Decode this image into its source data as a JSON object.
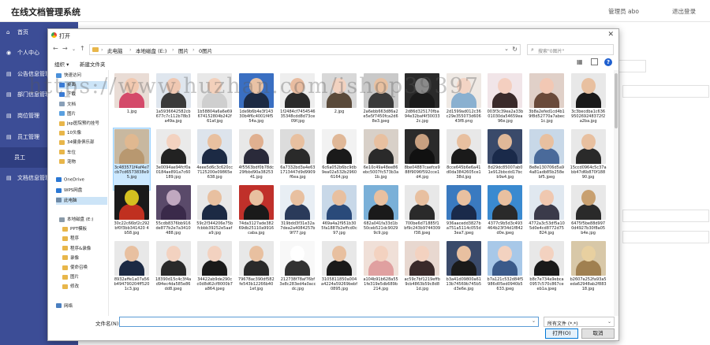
{
  "app": {
    "title": "在线文档管理系统",
    "user": "管理员 abo",
    "logout": "退出登录"
  },
  "sidebar": {
    "items": [
      {
        "label": "首页",
        "glyph": "⌂"
      },
      {
        "label": "个人中心",
        "glyph": "◉"
      },
      {
        "label": "公告信息管理",
        "glyph": "▤"
      },
      {
        "label": "部门信息管理",
        "glyph": "▤"
      },
      {
        "label": "岗位管理",
        "glyph": "▤"
      },
      {
        "label": "员工管理",
        "glyph": "▤"
      },
      {
        "label": "员工",
        "glyph": ""
      },
      {
        "label": "文档信息管理",
        "glyph": "▤"
      }
    ]
  },
  "dialog": {
    "title": "打开",
    "close": "✕",
    "breadcrumbs": [
      "此电脑",
      "本地磁盘 (E:)",
      "图片",
      "0图片"
    ],
    "search_placeholder": "搜索\"0图片\"",
    "organize": "组织 ▾",
    "new_folder": "新建文件夹",
    "help": "?"
  },
  "nav_tree": [
    {
      "label": "快速访问",
      "color": "#4a90d9",
      "pin": false,
      "selected": false
    },
    {
      "label": "桌面",
      "color": "#3a7bd5",
      "pin": true,
      "selected": true
    },
    {
      "label": "下载",
      "color": "#3a7bd5",
      "pin": true,
      "selected": false
    },
    {
      "label": "文档",
      "color": "#8aa0b8",
      "pin": true,
      "selected": false
    },
    {
      "label": "图片",
      "color": "#5aa0e0",
      "pin": true,
      "selected": false
    },
    {
      "label": "jsp医院预约挂号",
      "color": "#e8b64a",
      "pin": false,
      "selected": false
    },
    {
      "label": "10头像",
      "color": "#e8b64a",
      "pin": false,
      "selected": false
    },
    {
      "label": "34健身俱乐部",
      "color": "#e8b64a",
      "pin": false,
      "selected": false
    },
    {
      "label": "车位",
      "color": "#e8b64a",
      "pin": false,
      "selected": false
    },
    {
      "label": "宠物",
      "color": "#e8b64a",
      "pin": false,
      "selected": false
    },
    {
      "label": "",
      "color": "",
      "pin": false,
      "selected": false
    },
    {
      "label": "OneDrive",
      "color": "#2b78d4",
      "pin": false,
      "selected": false
    },
    {
      "label": "WPS网盘",
      "color": "#2b78d4",
      "pin": false,
      "selected": false
    },
    {
      "label": "此电脑",
      "color": "#6f8aa6",
      "pin": false,
      "selected": true
    },
    {
      "label": "",
      "color": "",
      "pin": false,
      "selected": false
    },
    {
      "label": "本地磁盘 (E:)",
      "color": "#8a9aa8",
      "pin": false,
      "selected": false
    },
    {
      "label": "PPT模板",
      "color": "#e8b64a",
      "pin": false,
      "selected": false
    },
    {
      "label": "程序",
      "color": "#e8b64a",
      "pin": false,
      "selected": false
    },
    {
      "label": "程序&录像",
      "color": "#e8b64a",
      "pin": false,
      "selected": false
    },
    {
      "label": "录像",
      "color": "#e8b64a",
      "pin": false,
      "selected": false
    },
    {
      "label": "使命召唤",
      "color": "#e8b64a",
      "pin": false,
      "selected": false
    },
    {
      "label": "图片",
      "color": "#e8b64a",
      "pin": false,
      "selected": false
    },
    {
      "label": "修改",
      "color": "#e8b64a",
      "pin": false,
      "selected": false
    },
    {
      "label": "",
      "color": "",
      "pin": false,
      "selected": false
    },
    {
      "label": "网络",
      "color": "#4a7fc0",
      "pin": false,
      "selected": false
    }
  ],
  "files": [
    {
      "name": "1.jpg",
      "bg": "#e9dcd5",
      "skin": "#f2c9b0",
      "cloth": "#d44a6a"
    },
    {
      "name": "1a5936642582cb677c7c112b78b3a49a.jpg",
      "bg": "#dfe6ee",
      "skin": "#f0c8b2",
      "cloth": "#3a3a3a"
    },
    {
      "name": "1b58804a6a6e69674152804b242f61af.jpg",
      "bg": "#e8e8e8",
      "skin": "#f3d0bb",
      "cloth": "#cfcfcf"
    },
    {
      "name": "1de9b6b4e3f14330b4f6c4001f4f554a.jpg",
      "bg": "#3a6fc2",
      "skin": "#e9c2a5",
      "cloth": "#1c2a44"
    },
    {
      "name": "1f2484cf745454635348cdd8d73ce09f.jpg",
      "bg": "#eeeeee",
      "skin": "#e8bca0",
      "cloth": "#2a2a2a"
    },
    {
      "name": "2.jpg",
      "bg": "#d8d8d8",
      "skin": "#f2d2c0",
      "cloth": "#5a4a3a"
    },
    {
      "name": "2a6ebb663d86a2e5e5f7450fca2d68e3.jpeg",
      "bg": "#c9c9c9",
      "skin": "#e8c0a0",
      "cloth": "#3a3a3a"
    },
    {
      "name": "2d86d325170fba94e32baf4f300332c.jpg",
      "bg": "#2a2a2a",
      "skin": "#8a8a8a",
      "cloth": "#1a1a1a"
    },
    {
      "name": "2d1599ad012c36c29e355073d60643f8.png",
      "bg": "#efe9e4",
      "skin": "#f3d4c4",
      "cloth": "#8ab0d0"
    },
    {
      "name": "003f3c39ea2a33b01030da54659ea96e.jpg",
      "bg": "#f1e5e8",
      "skin": "#f4cfc0",
      "cloth": "#3a2a2a"
    },
    {
      "name": "3b8a2efed1cd4b19f8d52770a7abec1c.jpg",
      "bg": "#e0d0c8",
      "skin": "#f2c8b4",
      "cloth": "#6a4a3a"
    },
    {
      "name": "3c3becdba1c636950269248372f2a2ba.jpg",
      "bg": "#e8e8e8",
      "skin": "#e8c0a0",
      "cloth": "#1a1a1a"
    },
    {
      "name": "3c483571f4af4e7cb7cd6573838e95.jpg",
      "bg": "#c8b8a0",
      "skin": "#e0b890",
      "cloth": "#b89870",
      "selected": true
    },
    {
      "name": "3e0094ae94fcf0a0184ae891a7c60189.jpg",
      "bg": "#eaeaea",
      "skin": "#f3d2c0",
      "cloth": "#222222"
    },
    {
      "name": "4eee5d6c3c620cc7125200e09865e638.jpg",
      "bg": "#dde4ec",
      "skin": "#e8c0a0",
      "cloth": "#1c2a44"
    },
    {
      "name": "4f5563bdf0b78dc29fbbd90a3825341.jpg",
      "bg": "#e8e8e8",
      "skin": "#e0b090",
      "cloth": "#2a2a3a"
    },
    {
      "name": "6a7332bd3a4e631713447d9d9909f6ea.jpg",
      "bg": "#dcdcdc",
      "skin": "#e8c0a0",
      "cloth": "#2a2a2a"
    },
    {
      "name": "6c6a052b6bc9db9ea02a532b29606164.jpg",
      "bg": "#f2f2f2",
      "skin": "#e0b898",
      "cloth": "#1a1a1a"
    },
    {
      "name": "6e10c49a48ee86ebc5007fc573b3a1b.jpg",
      "bg": "#d8d0c8",
      "skin": "#e8c0a0",
      "cloth": "#2a2a2a"
    },
    {
      "name": "8be04887caefce988f9096f592cce1d4.jpg",
      "bg": "#2a2a2a",
      "skin": "#c8a080",
      "cloth": "#111111"
    },
    {
      "name": "8cce645b6e6a41d0da3842605ce138d.jpg",
      "bg": "#e8e8e8",
      "skin": "#e8c0a0",
      "cloth": "#1a1a1a"
    },
    {
      "name": "8d29dc85007ab01e912bbcdd17bcb9a4.jpg",
      "bg": "#3a4a6a",
      "skin": "#e0b898",
      "cloth": "#1a2a4a"
    },
    {
      "name": "8e8e130706d5a94a81adb85b258ebf5.jpeg",
      "bg": "#c8d8e8",
      "skin": "#e8c0a0",
      "cloth": "#4a6a9a"
    },
    {
      "name": "15ccd0964c5c37abb47d6b870f18890.jpg",
      "bg": "#e8e8e8",
      "skin": "#e8c0a0",
      "cloth": "#2a2a2a"
    },
    {
      "name": "30c22c66bf2c292bf0f3bb341420 4b58.jpg",
      "bg": "#1a1a1a",
      "skin": "#d4c020",
      "cloth": "#c03020"
    },
    {
      "name": "55cdb8376bb916de877b2e7a3410488.jpg",
      "bg": "#5a4a6a",
      "skin": "#c0a8c0",
      "cloth": "#3a2a4a"
    },
    {
      "name": "59c2f344206e75bfcbbb39252e5aafa9.jpg",
      "bg": "#e8e8e8",
      "skin": "#e8c0a0",
      "cloth": "#1c2a44"
    },
    {
      "name": "74da3127ade38269db25110a9916caba.jpg",
      "bg": "#c0302a",
      "skin": "#e8c0a0",
      "cloth": "#1a1a1a"
    },
    {
      "name": "319bdd3f31e32a7dea2a4084257b9f77.jpg",
      "bg": "#e8eef4",
      "skin": "#e8c0a0",
      "cloth": "#2a3a5a"
    },
    {
      "name": "469a4a2f951b305fa1887b2effcd0c97.jpg",
      "bg": "#c8d8e8",
      "skin": "#e8c0a0",
      "cloth": "#2a4a7a"
    },
    {
      "name": "682a041fa33d1b50ceb521dc90299c9.jpg",
      "bg": "#7ab0d8",
      "skin": "#e8c0a0",
      "cloth": "#1a1a1a"
    },
    {
      "name": "700be6d71885f1bf9c243b9744309f38.jpeg",
      "bg": "#e8e8e8",
      "skin": "#e8c0a0",
      "cloth": "#2a2a2a"
    },
    {
      "name": "936aacedd3827ba751a5114c055d3ea7.jpeg",
      "bg": "#3a7ac0",
      "skin": "#e8c0a0",
      "cloth": "#1a2a4a"
    },
    {
      "name": "4377c9b5d3c493464b23f34d1f842d0e.jpeg",
      "bg": "#3a8ad0",
      "skin": "#e8c0a0",
      "cloth": "#2a2a2a"
    },
    {
      "name": "4772a3c53df5a105d0e4cd8772d75824.jpg",
      "bg": "#e0e8f0",
      "skin": "#f0c8b0",
      "cloth": "#3a3a4a"
    },
    {
      "name": "6475f5be88d9970d4927b30f8a05b4e.jpg",
      "bg": "#e8e8e8",
      "skin": "#c8a070",
      "cloth": "#2a2a2a"
    },
    {
      "name": "8932affe1a07a56b494790204ff520 1c3.jpg",
      "bg": "#e8e8e8",
      "skin": "#e8c0a0",
      "cloth": "#1c2a44"
    },
    {
      "name": "18390d15c4c3f4ad94ec4da585e86dd8.jpeg",
      "bg": "#e8e8e8",
      "skin": "#f3d2c0",
      "cloth": "#2a2a2a"
    },
    {
      "name": "34422ab9de290cc0d8d62cf8000b7a864.jpeg",
      "bg": "#e8e8e8",
      "skin": "#f3d2c0",
      "cloth": "#1a1a1a"
    },
    {
      "name": "79678ac390df582fe543b12266b401ef.jpg",
      "bg": "#e8e8e8",
      "skin": "#e8c0a0",
      "cloth": "#2a2a2a"
    },
    {
      "name": "212738f78af76bf3e8c283ed4a0accdc.jpg",
      "bg": "#f8f8f8",
      "skin": "#ffffff",
      "cloth": "#333333"
    },
    {
      "name": "3105811850a004a4224a59269bebf0895.jpg",
      "bg": "#e8e8e8",
      "skin": "#e8c0a0",
      "cloth": "#1a1a1a"
    },
    {
      "name": "a104b91b628a551fe319e5db689b214.jpg",
      "bg": "#f0e0d8",
      "skin": "#f3d2c0",
      "cloth": "#e0a0a0"
    },
    {
      "name": "ac59c7bf1219effb9cb4863b59c8d81d.jpg",
      "bg": "#e8d8d0",
      "skin": "#f3d2c0",
      "cloth": "#3a2a2a"
    },
    {
      "name": "b3a41d09800a6113b74569b745b5d3e6e.jpg",
      "bg": "#3a4a6a",
      "skin": "#e8c0a0",
      "cloth": "#1a1a1a"
    },
    {
      "name": "b7a121c532d84f5986d05ed0940b5633.jpeg",
      "bg": "#a8c8e8",
      "skin": "#f3d2c0",
      "cloth": "#3a5a8a"
    },
    {
      "name": "b8c7e734a9ebca0957c570c867ceeb1a.jpeg",
      "bg": "#e8e8e8",
      "skin": "#f3d2c0",
      "cloth": "#1a1a1a"
    },
    {
      "name": "b2607a252fa93a5eda62948ab2f88318.jpg",
      "bg": "#d8c8a8",
      "skin": "#e8d0a0",
      "cloth": "#a08050"
    }
  ],
  "bottom": {
    "filename_label": "文件名(N):",
    "filetype": "所有文件 (*.*)",
    "open": "打开(O)",
    "cancel": "取消"
  },
  "watermark": "https://www.huzhan.com/ishop39397"
}
